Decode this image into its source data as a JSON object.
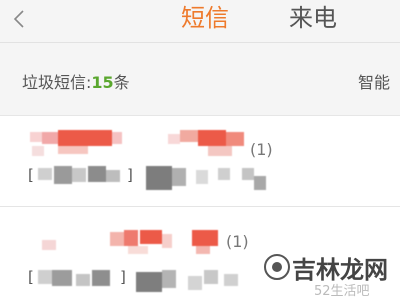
{
  "header": {
    "tabs": [
      {
        "label": "短信",
        "active": true
      },
      {
        "label": "来电",
        "active": false
      }
    ]
  },
  "spam_bar": {
    "prefix": "垃圾短信:",
    "count": "15",
    "suffix": "条",
    "right_label": "智能"
  },
  "messages": [
    {
      "count": "(1)",
      "sender_redacted": true,
      "preview_redacted": true
    },
    {
      "count": "(1)",
      "sender_redacted": true,
      "preview_redacted": true
    }
  ],
  "watermark": {
    "text": "吉林龙网",
    "sub": "52生活吧"
  },
  "colors": {
    "accent": "#ee7a2c",
    "count_green": "#5aa72e"
  }
}
